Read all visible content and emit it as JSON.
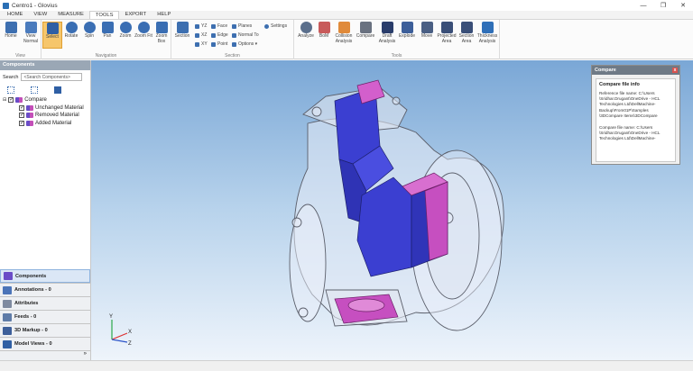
{
  "window": {
    "title": "Centro1 - Glovius",
    "controls": [
      "—",
      "❐",
      "✕"
    ]
  },
  "menu": {
    "tabs": [
      "HOME",
      "VIEW",
      "MEASURE",
      "TOOLS",
      "EXPORT",
      "HELP"
    ],
    "active": "TOOLS"
  },
  "ribbon": {
    "view": {
      "label": "View",
      "buttons": [
        "Home",
        "View Normal"
      ]
    },
    "navigation": {
      "label": "Navigation",
      "buttons": [
        "Select",
        "Rotate",
        "Spin",
        "Pan",
        "Zoom",
        "Zoom Fit",
        "Zoom Box"
      ]
    },
    "section": {
      "label": "Section",
      "button": "Section",
      "small": [
        "YZ",
        "XZ",
        "XY",
        "Face",
        "Edge",
        "Point",
        "Planes",
        "Normal To",
        "Options",
        "Settings"
      ]
    },
    "tools": {
      "label": "Tools",
      "buttons": [
        "Analyze",
        "BoM",
        "Collision Analysis",
        "Compare",
        "Draft Analysis",
        "Explode",
        "Move",
        "Projected Area",
        "Section Area",
        "Thickness Analysis"
      ]
    }
  },
  "left_panel": {
    "header": "Components",
    "search_label": "Search",
    "search_placeholder": "<Search Components>",
    "tree": {
      "root": "Compare",
      "children": [
        "Unchanged Material",
        "Removed Material",
        "Added Material"
      ]
    },
    "nav": [
      "Components",
      "Annotations - 0",
      "Attributes",
      "Feeds - 0",
      "3D Markup - 0",
      "Model Views - 0"
    ]
  },
  "compare_panel": {
    "header": "Compare",
    "title": "Compare file info",
    "reference": "Reference file name: C:\\Users \\Sridhar.Drugant\\OneDrive - HCL Technologies Ltd\\DellMachine-Backup\\From01P\\Samples \\3DCompare Items\\3DCompare",
    "compare": "Compare file name: C:\\Users \\Sridhar.Drugant\\OneDrive - HCL Technologies Ltd\\DellMachine-"
  },
  "axes": {
    "x": "X",
    "y": "Y",
    "z": "Z"
  },
  "colors": {
    "viewport_top": "#7aa7d6",
    "added": "#c64fc0",
    "unchanged": "#3b3fd1",
    "ribbon_select": "#f6c66b"
  }
}
